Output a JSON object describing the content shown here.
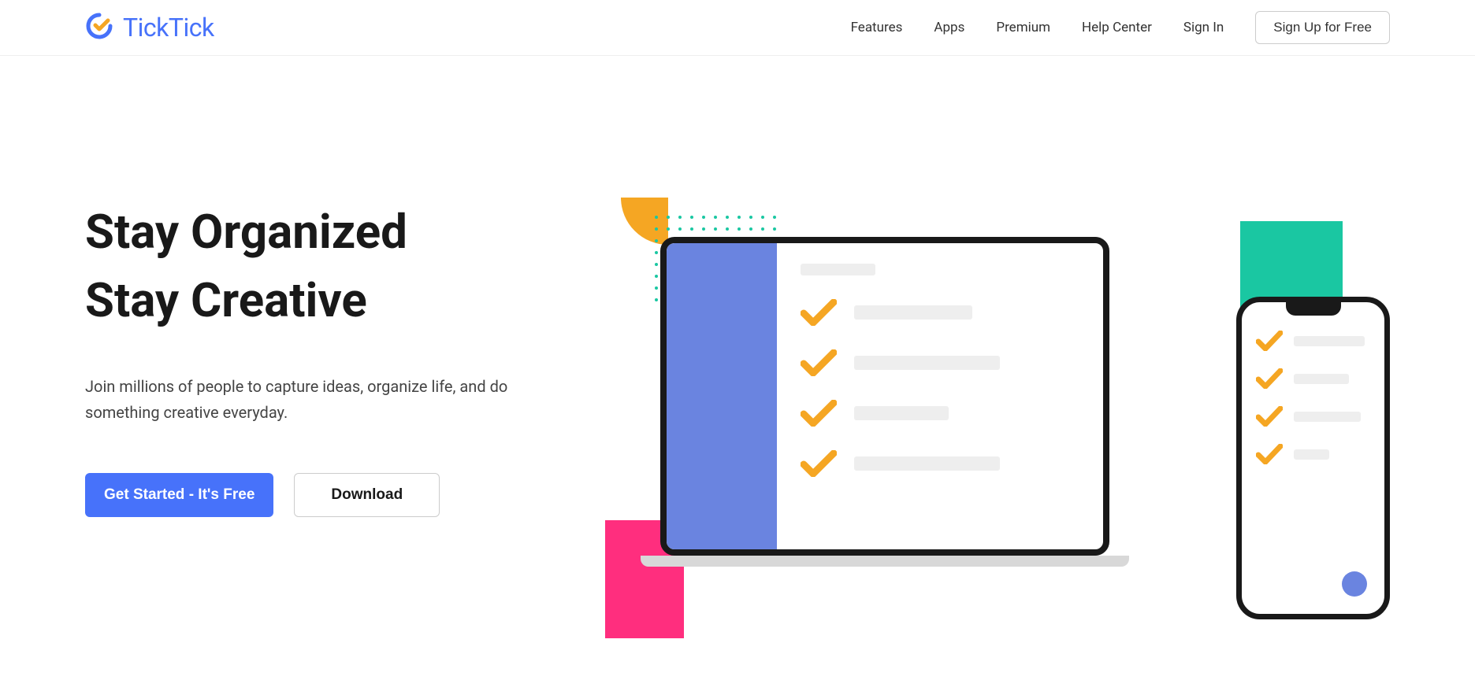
{
  "brand": {
    "name": "TickTick"
  },
  "nav": {
    "features": "Features",
    "apps": "Apps",
    "premium": "Premium",
    "help": "Help Center",
    "signin": "Sign In",
    "signup": "Sign Up for Free"
  },
  "hero": {
    "title_line1": "Stay Organized",
    "title_line2": "Stay Creative",
    "subtitle": "Join millions of people to capture ideas, organize life, and do something creative everyday.",
    "cta_primary": "Get Started - It's Free",
    "cta_secondary": "Download"
  }
}
